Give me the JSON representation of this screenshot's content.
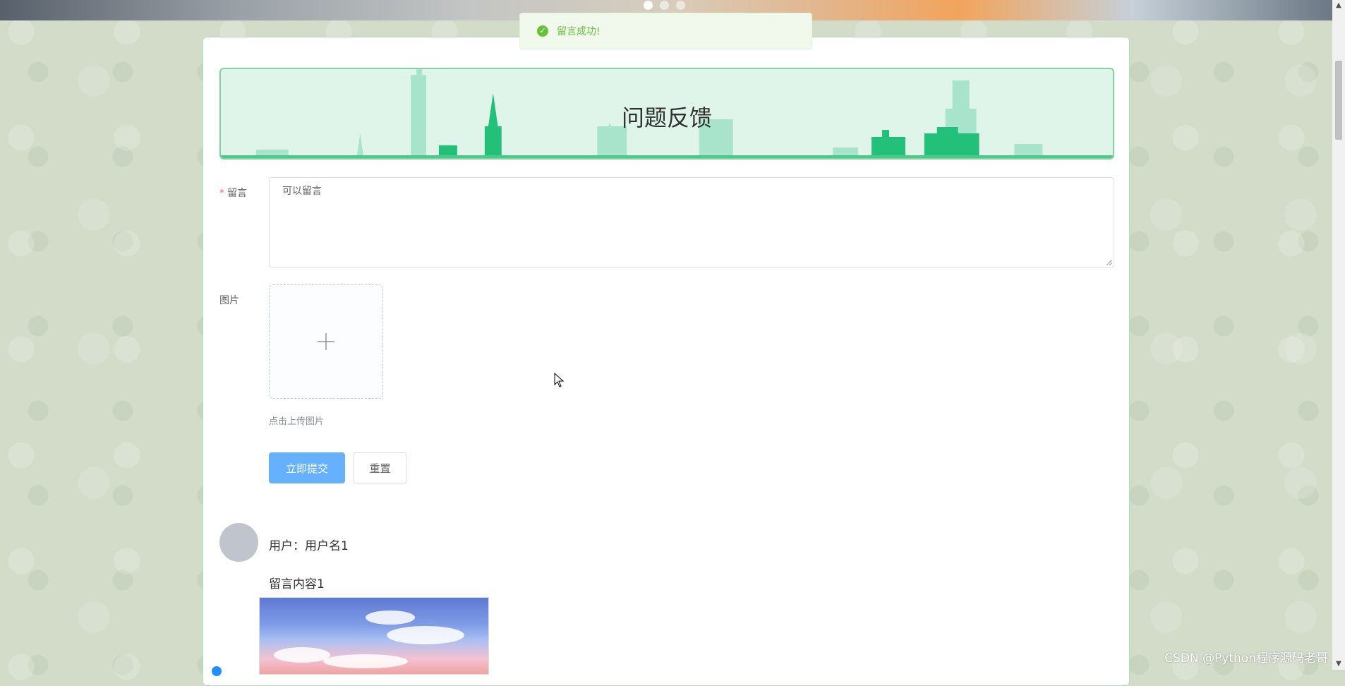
{
  "toast": {
    "message": "留言成功!",
    "icon": "check-circle-icon",
    "color": "#67c23a"
  },
  "banner": {
    "title": "问题反馈",
    "active_slide": 1,
    "slide_count": 3
  },
  "form": {
    "message_label": "留言",
    "message_required_mark": "*",
    "message_value": "可以留言",
    "image_label": "图片",
    "upload_hint": "点击上传图片",
    "submit_label": "立即提交",
    "reset_label": "重置"
  },
  "comments": [
    {
      "user_text": "用户：用户名1",
      "content": "留言内容1"
    }
  ],
  "watermark": "CSDN @Python程序源码老哥",
  "colors": {
    "accent": "#66b1ff",
    "banner_bg": "#e0f5ea",
    "banner_border": "#7fd4a2",
    "required": "#f56c6c"
  }
}
